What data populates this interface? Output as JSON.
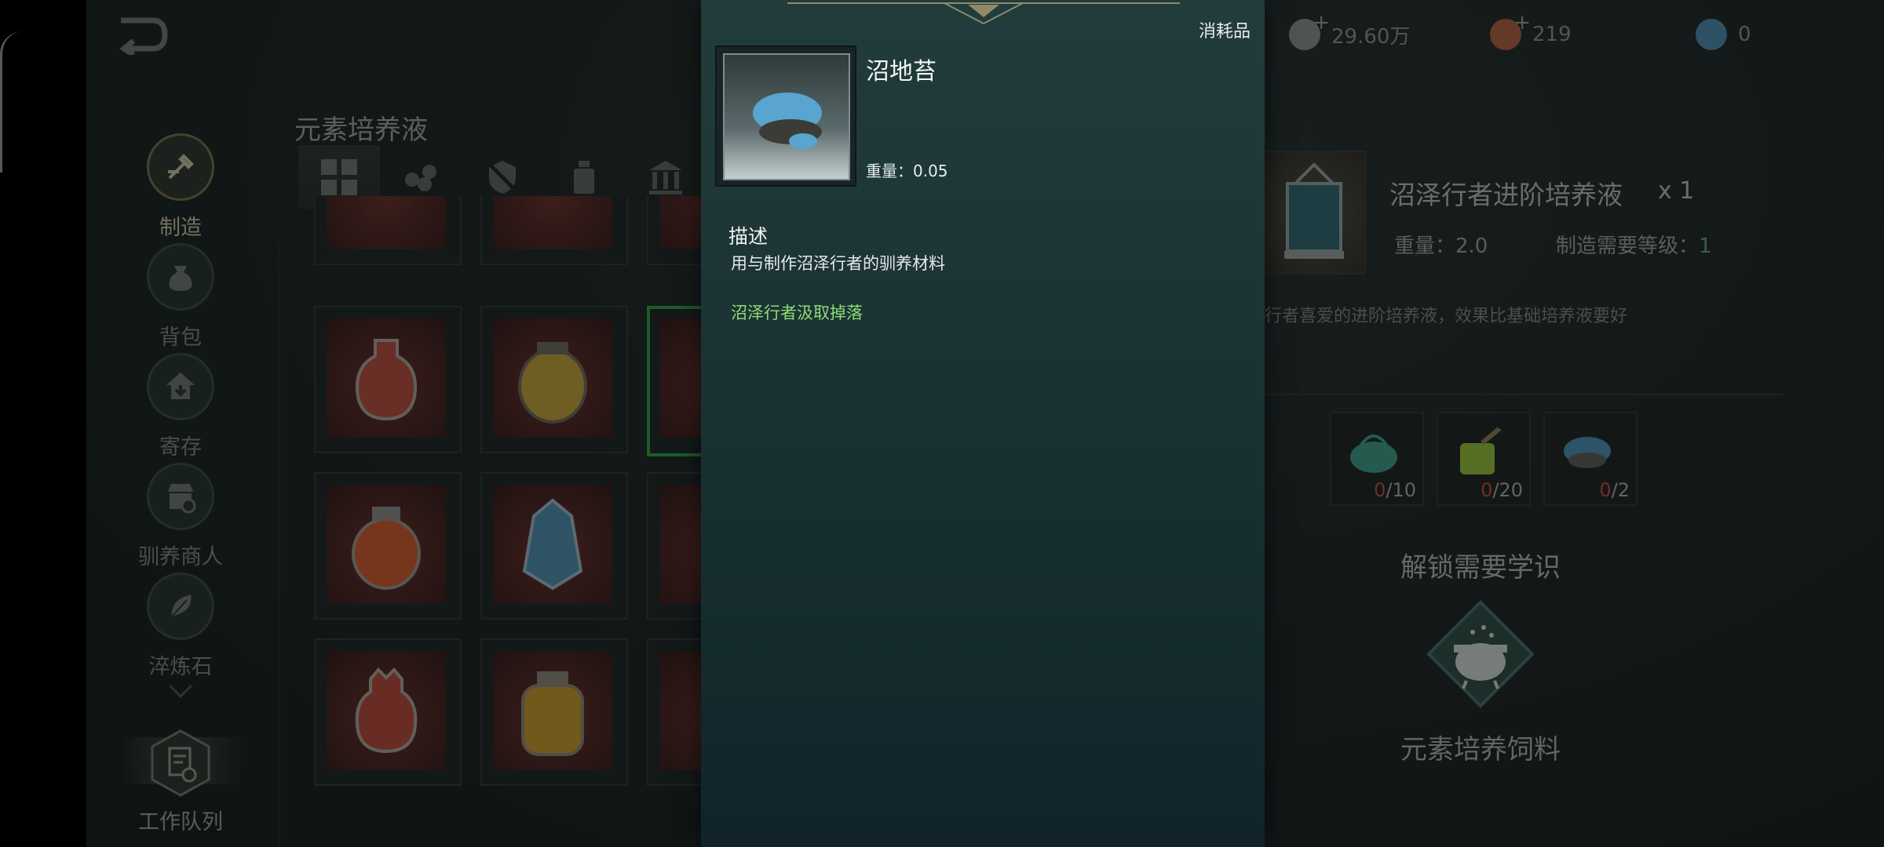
{
  "rail": {
    "items": [
      {
        "label": "制造",
        "icon": "craft-icon",
        "active": true
      },
      {
        "label": "背包",
        "icon": "bag-icon",
        "active": false
      },
      {
        "label": "寄存",
        "icon": "storage-icon",
        "active": false
      },
      {
        "label": "驯养商人",
        "icon": "merchant-icon",
        "active": false
      },
      {
        "label": "淬炼石",
        "icon": "leaf-stone-icon",
        "active": false
      }
    ],
    "queue_label": "工作队列"
  },
  "section_title": "元素培养液",
  "tabs": [
    "all-grid-icon",
    "logs-icon",
    "shield-crossed-icon",
    "bottle-icon",
    "temple-icon"
  ],
  "popup": {
    "category": "消耗品",
    "item_name": "沼地苔",
    "weight": "重量：0.05",
    "desc_title": "描述",
    "desc_text": "用与制作沼泽行者的驯养材料",
    "source": "沼泽行者汲取掉落"
  },
  "currency": [
    {
      "value": "29.60万",
      "icon": "silver-coin-icon",
      "color": "#8a8f8f"
    },
    {
      "value": "219",
      "icon": "copper-coin-icon",
      "color": "#b0603e"
    },
    {
      "value": "0",
      "icon": "gem-icon",
      "color": "#4e8bb0"
    }
  ],
  "detail": {
    "name": "沼泽行者进阶培养液",
    "qty": "x 1",
    "weight": "重量：2.0",
    "level_label": "制造需要等级：",
    "level_value": "1",
    "desc": "行者喜爱的进阶培养液，效果比基础培养液要好",
    "materials": [
      {
        "have": "0",
        "need": "/10",
        "color": "#3d9c88"
      },
      {
        "have": "0",
        "need": "/20",
        "color": "#97c23a"
      },
      {
        "have": "0",
        "need": "/2",
        "color": "#4a8fb3"
      }
    ],
    "unlock_title": "解锁需要学识",
    "unlock_name": "元素培养饲料"
  },
  "colors": {
    "accent_green": "#2fa040",
    "source_green": "#8fdc74",
    "count_red": "#c4493d"
  }
}
